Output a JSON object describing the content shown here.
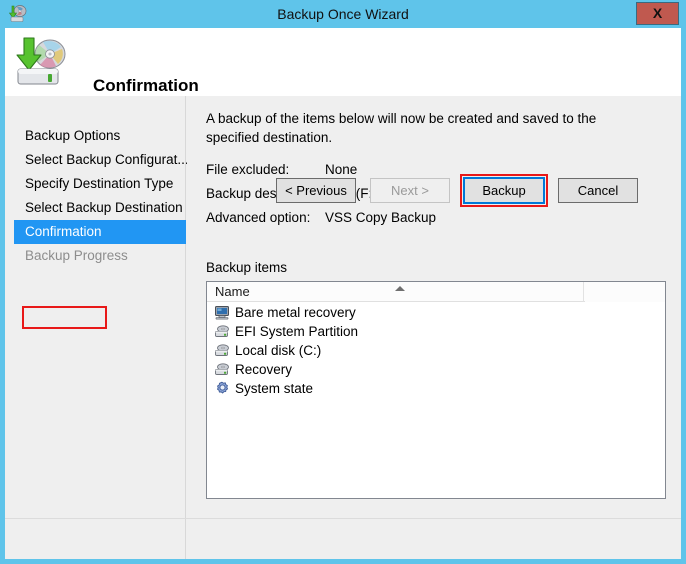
{
  "window": {
    "title": "Backup Once Wizard",
    "title_icon": "backup-wizard-icon",
    "close_label": "X"
  },
  "banner": {
    "icon": "backup-disk-icon",
    "heading": "Confirmation"
  },
  "sidebar": {
    "items": [
      {
        "label": "Backup Options",
        "state": "normal"
      },
      {
        "label": "Select Backup Configurat...",
        "state": "normal"
      },
      {
        "label": "Specify Destination Type",
        "state": "normal"
      },
      {
        "label": "Select Backup Destination",
        "state": "normal"
      },
      {
        "label": "Confirmation",
        "state": "selected"
      },
      {
        "label": "Backup Progress",
        "state": "disabled"
      }
    ]
  },
  "content": {
    "intro": "A backup of the items below will now be created and saved to the specified destination.",
    "details": [
      {
        "label": "File excluded:",
        "value": "None"
      },
      {
        "label": "Backup destination:",
        "value": "New (F:)"
      },
      {
        "label": "Advanced option:",
        "value": "VSS Copy Backup"
      }
    ],
    "items_label": "Backup items",
    "listview": {
      "columns": [
        "Name"
      ],
      "sort_indicator": "sort-ascending-icon",
      "rows": [
        {
          "name": "Bare metal recovery",
          "icon": "computer-icon"
        },
        {
          "name": "EFI System Partition",
          "icon": "drive-icon"
        },
        {
          "name": "Local disk (C:)",
          "icon": "drive-icon"
        },
        {
          "name": "Recovery",
          "icon": "drive-icon"
        },
        {
          "name": "System state",
          "icon": "gear-icon"
        }
      ]
    }
  },
  "footer": {
    "buttons": [
      {
        "label": "< Previous",
        "state": "normal"
      },
      {
        "label": "Next >",
        "state": "disabled"
      },
      {
        "label": "Backup",
        "state": "focused"
      },
      {
        "label": "Cancel",
        "state": "normal"
      }
    ]
  },
  "colors": {
    "title_bar": "#5fc4ea",
    "selection": "#2196f3",
    "annotation": "#e81818",
    "close_button": "#c0594f"
  }
}
